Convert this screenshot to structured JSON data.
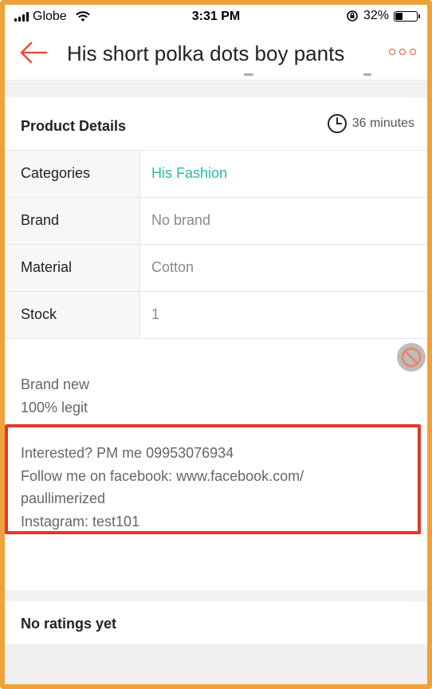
{
  "status_bar": {
    "carrier": "Globe",
    "time": "3:31 PM",
    "battery_percent": "32%",
    "battery_level": 0.32,
    "icons": [
      "signal-icon",
      "wifi-icon",
      "rotation-lock-icon",
      "battery-icon"
    ]
  },
  "header": {
    "title": "His short polka dots boy pants",
    "back_icon": "arrow-left-icon",
    "more_icon": "more-dots-icon",
    "accent_color": "#e0523a"
  },
  "product_details": {
    "heading": "Product Details",
    "time_icon": "clock-icon",
    "time_ago": "36 minutes",
    "rows": [
      {
        "label": "Categories",
        "value": "His Fashion",
        "is_link": true
      },
      {
        "label": "Brand",
        "value": "No brand",
        "is_link": false
      },
      {
        "label": "Material",
        "value": "Cotton",
        "is_link": false
      },
      {
        "label": "Stock",
        "value": "1",
        "is_link": false
      }
    ],
    "link_color": "#2fb8a0"
  },
  "description": {
    "lines_top": [
      "Brand new",
      "100% legit"
    ],
    "lines_highlighted": [
      "Interested? PM me 09953076934",
      "Follow me on facebook: www.facebook.com/",
      "paullimerized",
      "Instagram: test101"
    ],
    "highlight_color": "#e0392b",
    "side_icon": "prohibited-icon"
  },
  "ratings": {
    "label": "No ratings yet"
  },
  "frame_color": "#f0a23a"
}
